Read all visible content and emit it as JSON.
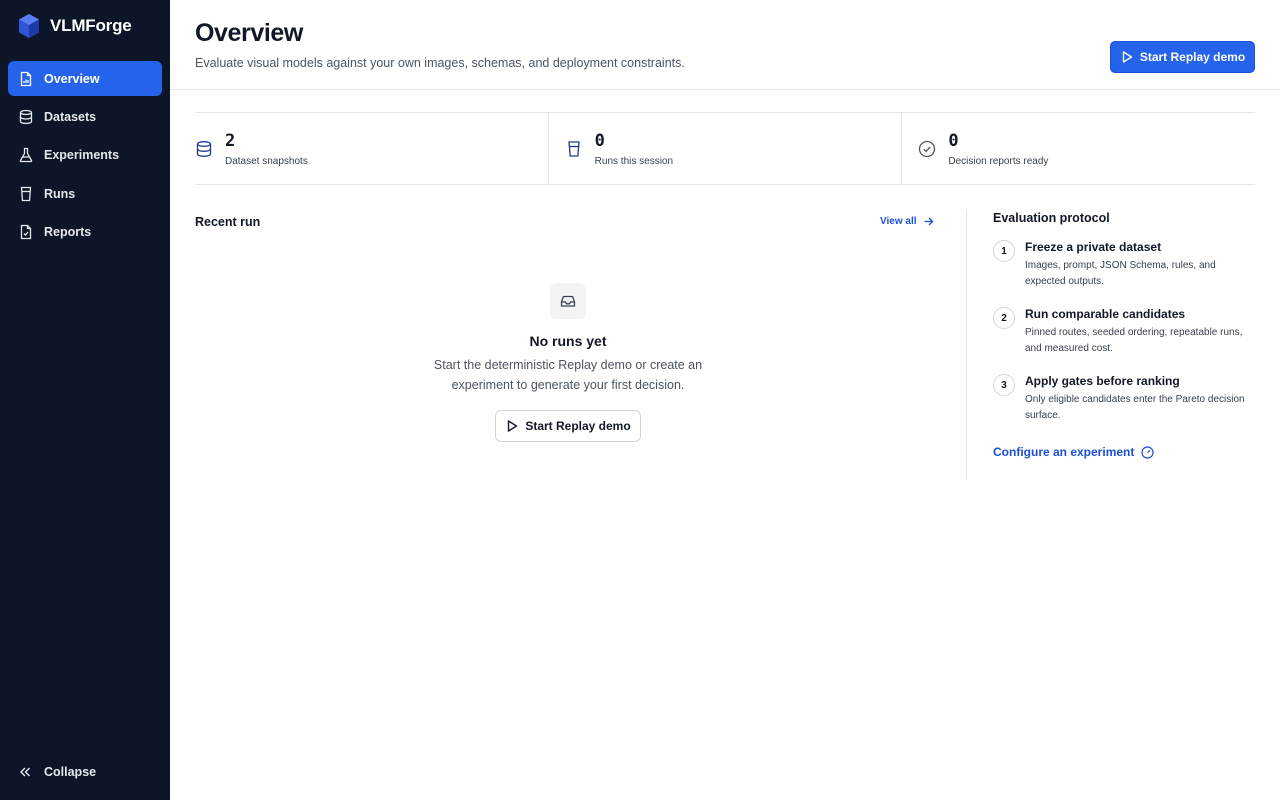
{
  "app": {
    "brand_name": "VLMForge"
  },
  "sidebar": {
    "items": [
      {
        "label": "Overview",
        "icon": "document-chart-icon",
        "active": true
      },
      {
        "label": "Datasets",
        "icon": "database-icon",
        "active": false
      },
      {
        "label": "Experiments",
        "icon": "flask-icon",
        "active": false
      },
      {
        "label": "Runs",
        "icon": "cup-icon",
        "active": false
      },
      {
        "label": "Reports",
        "icon": "report-icon",
        "active": false
      }
    ],
    "collapse_label": "Collapse"
  },
  "header": {
    "title": "Overview",
    "subtitle": "Evaluate visual models against your own images, schemas, and deployment constraints.",
    "primary_button_label": "Start Replay demo"
  },
  "stats": [
    {
      "value": "2",
      "label": "Dataset snapshots",
      "icon": "database-icon"
    },
    {
      "value": "0",
      "label": "Runs this session",
      "icon": "cup-icon"
    },
    {
      "value": "0",
      "label": "Decision reports ready",
      "icon": "check-circle-icon"
    }
  ],
  "recent_run": {
    "title": "Recent run",
    "view_all_label": "View all",
    "empty_title": "No runs yet",
    "empty_description": "Start the deterministic Replay demo or create an experiment to generate your first decision.",
    "button_label": "Start Replay demo"
  },
  "protocol": {
    "title": "Evaluation protocol",
    "steps": [
      {
        "number": "1",
        "title": "Freeze a private dataset",
        "description": "Images, prompt, JSON Schema, rules, and expected outputs."
      },
      {
        "number": "2",
        "title": "Run comparable candidates",
        "description": "Pinned routes, seeded ordering, repeatable runs, and measured cost."
      },
      {
        "number": "3",
        "title": "Apply gates before ranking",
        "description": "Only eligible candidates enter the Pareto decision surface."
      }
    ],
    "configure_link_label": "Configure an experiment"
  },
  "colors": {
    "sidebar_bg": "#0c1628",
    "accent": "#2563eb",
    "link": "#1d4ed8"
  }
}
